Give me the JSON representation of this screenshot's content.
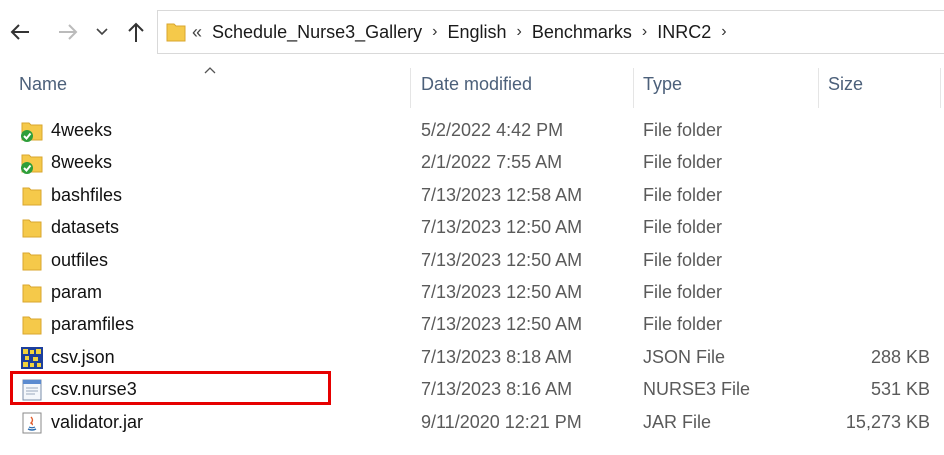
{
  "nav": {
    "back_icon": "arrow-left-icon",
    "forward_icon": "arrow-right-icon",
    "recent_icon": "chevron-down-icon",
    "up_icon": "arrow-up-icon"
  },
  "address": {
    "overflow": "«",
    "crumbs": [
      "Schedule_Nurse3_Gallery",
      "English",
      "Benchmarks",
      "INRC2"
    ],
    "separator": "›"
  },
  "columns": {
    "name": "Name",
    "date": "Date modified",
    "type": "Type",
    "size": "Size"
  },
  "files": [
    {
      "name": "4weeks",
      "date": "5/2/2022 4:42 PM",
      "type": "File folder",
      "size": "",
      "icon": "synced-folder-icon"
    },
    {
      "name": "8weeks",
      "date": "2/1/2022 7:55 AM",
      "type": "File folder",
      "size": "",
      "icon": "synced-folder-icon"
    },
    {
      "name": "bashfiles",
      "date": "7/13/2023 12:58 AM",
      "type": "File folder",
      "size": "",
      "icon": "folder-icon"
    },
    {
      "name": "datasets",
      "date": "7/13/2023 12:50 AM",
      "type": "File folder",
      "size": "",
      "icon": "folder-icon"
    },
    {
      "name": "outfiles",
      "date": "7/13/2023 12:50 AM",
      "type": "File folder",
      "size": "",
      "icon": "folder-icon"
    },
    {
      "name": "param",
      "date": "7/13/2023 12:50 AM",
      "type": "File folder",
      "size": "",
      "icon": "folder-icon"
    },
    {
      "name": "paramfiles",
      "date": "7/13/2023 12:50 AM",
      "type": "File folder",
      "size": "",
      "icon": "folder-icon"
    },
    {
      "name": "csv.json",
      "date": "7/13/2023 8:18 AM",
      "type": "JSON File",
      "size": "288 KB",
      "icon": "json-file-icon"
    },
    {
      "name": "csv.nurse3",
      "date": "7/13/2023 8:16 AM",
      "type": "NURSE3 File",
      "size": "531 KB",
      "icon": "generic-file-icon"
    },
    {
      "name": "validator.jar",
      "date": "9/11/2020 12:21 PM",
      "type": "JAR File",
      "size": "15,273 KB",
      "icon": "java-jar-icon"
    }
  ],
  "colors": {
    "folder": "#f5c94a",
    "highlight": "#e60000",
    "header_text": "#4c607a"
  }
}
